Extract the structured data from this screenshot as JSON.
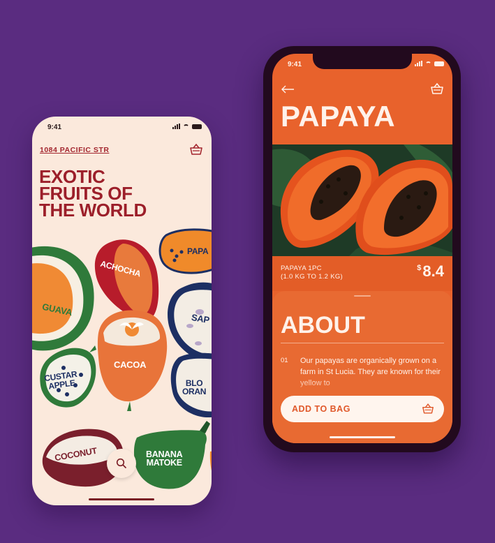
{
  "left_screen": {
    "status_time": "9:41",
    "address": "1084 PACIFIC STR",
    "headline_lines": [
      "EXOTIC",
      "FRUITS OF",
      "THE WORLD"
    ],
    "fruits": {
      "guava": "GUAVA",
      "achocha": "ACHOCHA",
      "papaya": "PAPA",
      "sapodilla": "SAP",
      "custard_line1": "CUSTAR",
      "custard_line2": "APPLE",
      "cacoa": "CACOA",
      "blood_line1": "BLO",
      "blood_line2": "ORAN",
      "coconut": "COCONUT",
      "banana_line1": "BANANA",
      "banana_line2": "MATOKE"
    },
    "icons": [
      "basket-icon",
      "search-icon"
    ]
  },
  "right_screen": {
    "status_time": "9:41",
    "title": "PAPAYA",
    "product_desc_line1": "PAPAYA 1PC",
    "product_desc_line2": "(1.0 KG TO 1.2 KG)",
    "price_currency": "$",
    "price_value": "8.4",
    "about_title": "ABOUT",
    "about_index": "01",
    "about_text": "Our papayas are organically grown on a farm in St Lucia. They are known for their yellow to",
    "add_to_bag": "ADD TO BAG",
    "icons": [
      "back-arrow-icon",
      "basket-icon"
    ]
  },
  "colors": {
    "background": "#5a2c80",
    "left_bg": "#fbe9dc",
    "left_accent": "#9c1f2a",
    "right_bg": "#e8622c",
    "right_text": "#fff2ea"
  }
}
